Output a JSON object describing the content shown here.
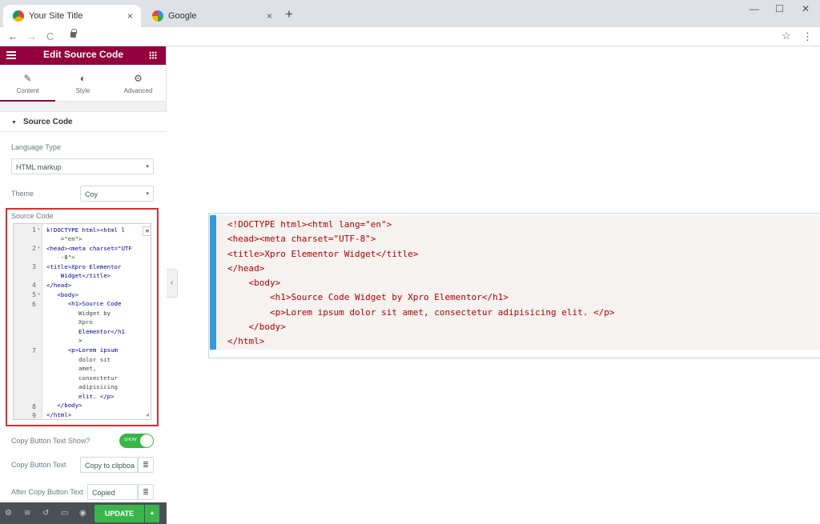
{
  "browser": {
    "tabs": [
      {
        "title": "Your Site Title",
        "active": true
      },
      {
        "title": "Google",
        "active": false
      }
    ],
    "close_glyph": "×",
    "new_tab_glyph": "+",
    "nav": {
      "back": "←",
      "forward": "→",
      "reload": "C"
    },
    "window_controls": {
      "minimize": "—",
      "maximize": "☐",
      "close": "✕"
    },
    "star": "☆",
    "menu": "⋮"
  },
  "panel": {
    "header_title": "Edit Source Code",
    "tabs": [
      {
        "icon": "✎",
        "label": "Content"
      },
      {
        "icon": "◐",
        "label": "Style"
      },
      {
        "icon": "⚙",
        "label": "Advanced"
      }
    ],
    "section_title": "Source Code",
    "section_caret": "▼",
    "language_label": "Language Type",
    "language_value": "HTML markup",
    "theme_label": "Theme",
    "theme_value": "Coy",
    "source_label": "Source Code",
    "copy_show_label": "Copy Button Text Show?",
    "copy_show_toggle": "SHOW",
    "copy_text_label": "Copy Button Text",
    "copy_text_value": "Copy to clipboa",
    "after_copy_label": "After Copy Button Text",
    "after_copy_value": "Copied",
    "update_label": "UPDATE",
    "dropdown_glyph": "▾",
    "collapse_glyph": "‹",
    "footer_icons": [
      "gear-icon",
      "layers-icon",
      "history-icon",
      "responsive-icon",
      "preview-eye-icon"
    ]
  },
  "editor": {
    "line_numbers": [
      "1",
      "2",
      "3",
      "4",
      "5",
      "6",
      "7",
      "8",
      "9"
    ],
    "fold_markers": [
      "▾",
      "▾",
      "▾"
    ],
    "lines": [
      "k!DOCTYPE html><html l",
      "    =\"en\">",
      "<head><meta charset=\"UTF",
      "    -8\">",
      "<title>Xpro Elementor",
      "    Widget</title>",
      "</head>",
      "   <body>",
      "      <h1>Source Code",
      "         Widget by",
      "         Xpro",
      "         Elementor</h1",
      "         >",
      "      <p>Lorem ipsum",
      "         dolor sit",
      "         amet,",
      "         consectetur",
      "         adipisicing",
      "         elit. </p>",
      "   </body>",
      "</html>"
    ]
  },
  "preview": {
    "lines": [
      "<!DOCTYPE html><html lang=\"en\">",
      "<head><meta charset=\"UTF-8\">",
      "<title>Xpro Elementor Widget</title>",
      "</head>",
      "    <body>",
      "        <h1>Source Code Widget by Xpro Elementor</h1>",
      "        <p>Lorem ipsum dolor sit amet, consectetur adipisicing elit. </p>",
      "    </body>",
      "</html>"
    ]
  },
  "colors": {
    "brand": "#93003c",
    "update": "#39b54a",
    "preview_border": "#3498db"
  }
}
